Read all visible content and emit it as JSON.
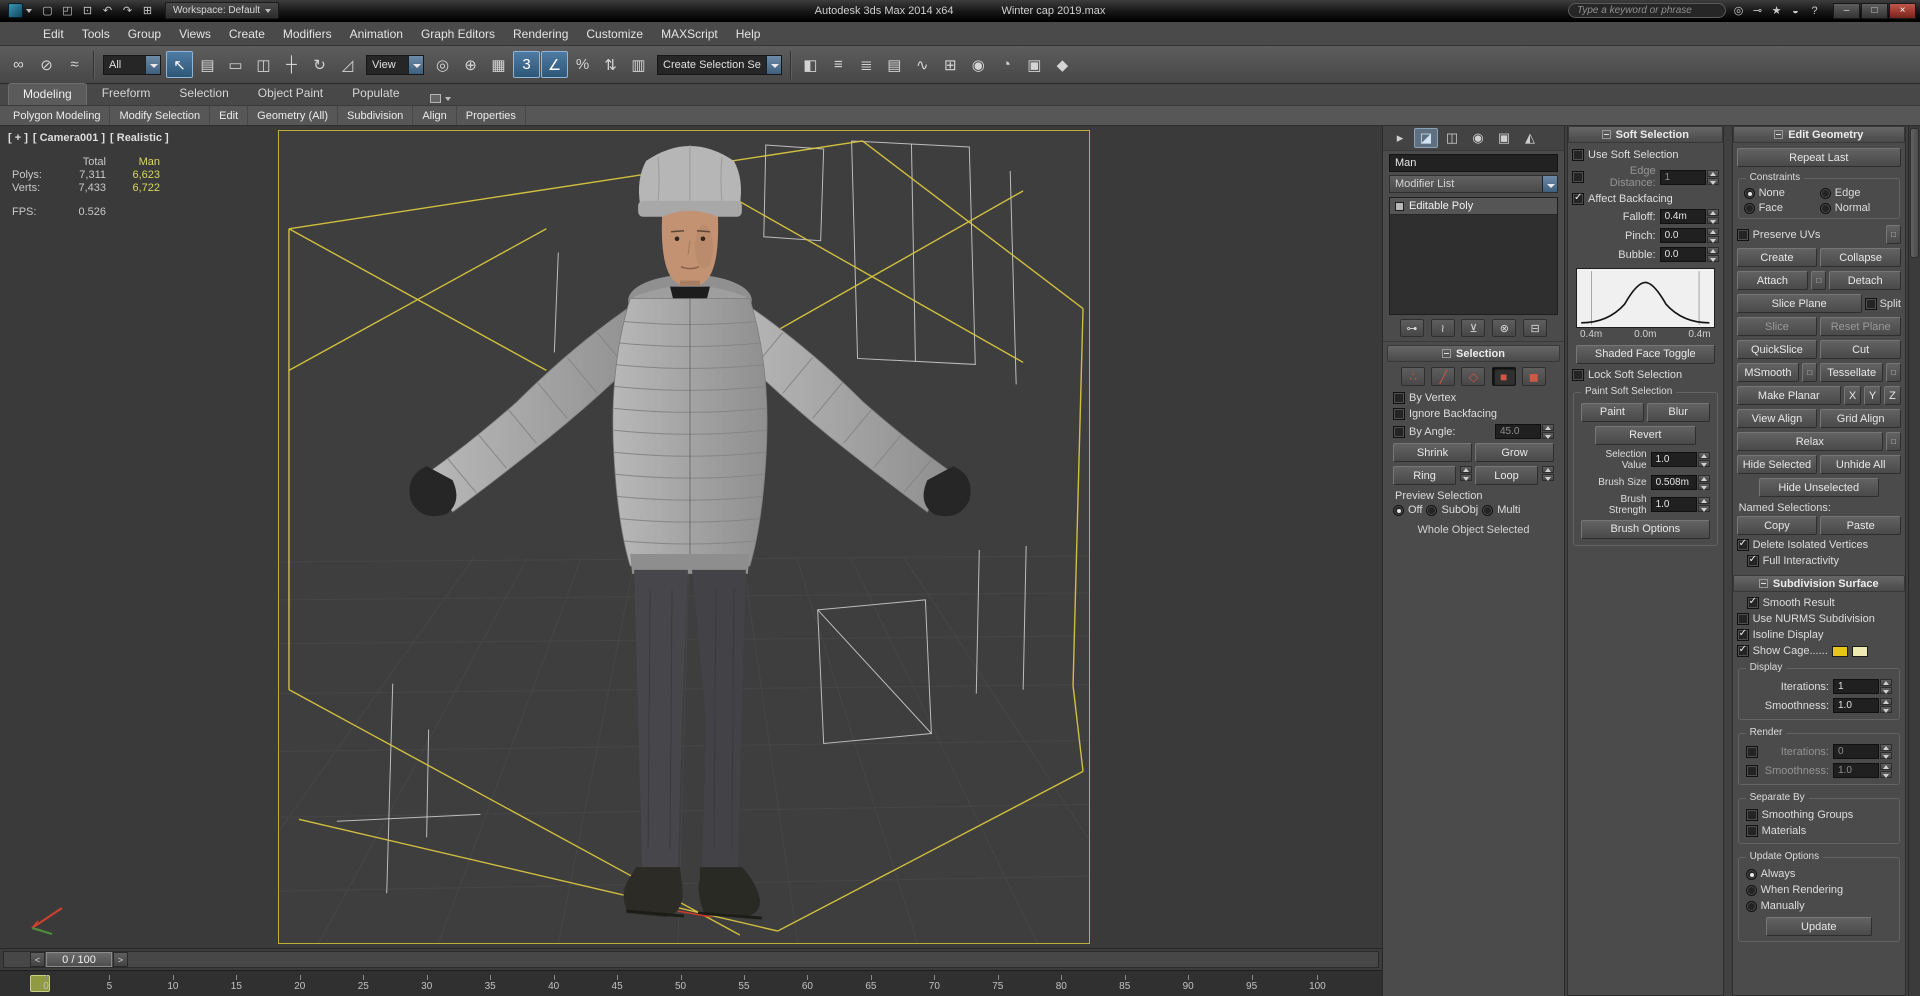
{
  "colors": {
    "cage_yellow": "#d8c63e",
    "viewport_border_yellow": "#c2ae36",
    "selection_stats_yellow": "#d8d85e",
    "accent_blue": "#3e5f7d",
    "close_button_red": "#77231a",
    "cage_swatch_yellow": "#e6c619",
    "cage_swatch_pale": "#efeab2",
    "frame_marker_olive": "#8f9a42"
  },
  "title_bar": {
    "app_title": "Autodesk 3ds Max 2014 x64",
    "file_name": "Winter cap 2019.max",
    "workspace_label": "Workspace: Default",
    "search_placeholder": "Type a keyword or phrase",
    "quick_access": [
      {
        "name": "new-scene-icon",
        "glyph": "▢"
      },
      {
        "name": "open-file-icon",
        "glyph": "◰"
      },
      {
        "name": "save-file-icon",
        "glyph": "⊡"
      },
      {
        "name": "undo-icon",
        "glyph": "↶"
      },
      {
        "name": "redo-icon",
        "glyph": "↷"
      },
      {
        "name": "project-folder-icon",
        "glyph": "⊞"
      }
    ],
    "right_icons": [
      {
        "name": "infocenter-search-icon",
        "glyph": "◎"
      },
      {
        "name": "sign-in-icon",
        "glyph": "⊸"
      },
      {
        "name": "favorites-icon",
        "glyph": "★"
      },
      {
        "name": "communication-center-icon",
        "glyph": "◒"
      },
      {
        "name": "help-icon",
        "glyph": "?"
      }
    ],
    "window_controls": [
      {
        "name": "minimize-button",
        "glyph": "–"
      },
      {
        "name": "maximize-button",
        "glyph": "□"
      },
      {
        "name": "close-button",
        "glyph": "×"
      }
    ]
  },
  "menu_bar": {
    "items": [
      {
        "name": "menu-edit",
        "label": "Edit"
      },
      {
        "name": "menu-tools",
        "label": "Tools"
      },
      {
        "name": "menu-group",
        "label": "Group"
      },
      {
        "name": "menu-views",
        "label": "Views"
      },
      {
        "name": "menu-create",
        "label": "Create"
      },
      {
        "name": "menu-modifiers",
        "label": "Modifiers"
      },
      {
        "name": "menu-animation",
        "label": "Animation"
      },
      {
        "name": "menu-graph-editors",
        "label": "Graph Editors"
      },
      {
        "name": "menu-rendering",
        "label": "Rendering"
      },
      {
        "name": "menu-customize",
        "label": "Customize"
      },
      {
        "name": "menu-maxscript",
        "label": "MAXScript"
      },
      {
        "name": "menu-help",
        "label": "Help"
      }
    ]
  },
  "toolbar": {
    "filter_value": "All",
    "coords_value": "View",
    "sets_value": "Create Selection Se",
    "group1": [
      {
        "name": "select-and-link-icon",
        "glyph": "∞"
      },
      {
        "name": "unlink-selection-icon",
        "glyph": "⊘"
      },
      {
        "name": "bind-to-space-warp-icon",
        "glyph": "≈"
      }
    ],
    "group2": [
      {
        "name": "select-object-icon",
        "glyph": "↖",
        "active": true
      },
      {
        "name": "select-by-name-icon",
        "glyph": "▤"
      },
      {
        "name": "selection-region-icon",
        "glyph": "▭"
      },
      {
        "name": "window-crossing-icon",
        "glyph": "◫"
      },
      {
        "name": "select-and-move-icon",
        "glyph": "┼"
      },
      {
        "name": "select-and-rotate-icon",
        "glyph": "↻"
      },
      {
        "name": "select-and-scale-icon",
        "glyph": "◿"
      }
    ],
    "group3": [
      {
        "name": "use-pivot-center-icon",
        "glyph": "◎"
      },
      {
        "name": "select-and-manipulate-icon",
        "glyph": "⊕"
      },
      {
        "name": "keyboard-override-icon",
        "glyph": "▦"
      },
      {
        "name": "snaps-toggle-icon",
        "glyph": "3",
        "active": true
      },
      {
        "name": "angle-snap-icon",
        "glyph": "∠",
        "active": true
      },
      {
        "name": "percent-snap-icon",
        "glyph": "%"
      },
      {
        "name": "spinner-snap-icon",
        "glyph": "⇅"
      },
      {
        "name": "named-selection-sets-icon",
        "glyph": "▥"
      }
    ],
    "group4": [
      {
        "name": "mirror-icon",
        "glyph": "◧"
      },
      {
        "name": "align-icon",
        "glyph": "≡"
      },
      {
        "name": "layer-manager-icon",
        "glyph": "≣"
      },
      {
        "name": "ribbon-toggle-icon",
        "glyph": "▤"
      },
      {
        "name": "curve-editor-icon",
        "glyph": "∿"
      },
      {
        "name": "schematic-view-icon",
        "glyph": "⊞"
      },
      {
        "name": "material-editor-icon",
        "glyph": "◉"
      },
      {
        "name": "render-setup-icon",
        "glyph": "◔"
      },
      {
        "name": "rendered-frame-icon",
        "glyph": "▣"
      },
      {
        "name": "render-production-icon",
        "glyph": "◆"
      }
    ]
  },
  "ribbon": {
    "tabs": [
      {
        "name": "tab-modeling",
        "label": "Modeling",
        "active": true
      },
      {
        "name": "tab-freeform",
        "label": "Freeform"
      },
      {
        "name": "tab-selection",
        "label": "Selection"
      },
      {
        "name": "tab-object-paint",
        "label": "Object Paint"
      },
      {
        "name": "tab-populate",
        "label": "Populate"
      }
    ],
    "panels": [
      {
        "name": "ribbon-panel-polygon-modeling",
        "label": "Polygon Modeling"
      },
      {
        "name": "ribbon-panel-modify-selection",
        "label": "Modify Selection"
      },
      {
        "name": "ribbon-panel-edit",
        "label": "Edit"
      },
      {
        "name": "ribbon-panel-geometry-all",
        "label": "Geometry (All)"
      },
      {
        "name": "ribbon-panel-subdivision",
        "label": "Subdivision"
      },
      {
        "name": "ribbon-panel-align",
        "label": "Align"
      },
      {
        "name": "ribbon-panel-properties",
        "label": "Properties"
      }
    ]
  },
  "viewport": {
    "menu_plus": "[ + ]",
    "menu_camera": "[ Camera001 ]",
    "menu_shading": "[ Realistic ]",
    "stats": {
      "header_total": "Total",
      "header_selection": "Man",
      "polys_label": "Polys:",
      "polys_total": "7,311",
      "polys_sel": "6,623",
      "verts_label": "Verts:",
      "verts_total": "7,433",
      "verts_sel": "6,722",
      "fps_label": "FPS:",
      "fps_value": "0.526"
    }
  },
  "command_panel": {
    "tabs": [
      {
        "name": "create-tab-icon",
        "glyph": "▸"
      },
      {
        "name": "modify-tab-icon",
        "glyph": "◪",
        "active": true
      },
      {
        "name": "hierarchy-tab-icon",
        "glyph": "◫"
      },
      {
        "name": "motion-tab-icon",
        "glyph": "◉"
      },
      {
        "name": "display-tab-icon",
        "glyph": "▣"
      },
      {
        "name": "utilities-tab-icon",
        "glyph": "◭"
      }
    ],
    "object_name": "Man",
    "modifier_list_label": "Modifier List",
    "stack": [
      {
        "name": "stack-item-editable-poly",
        "label": "Editable Poly"
      }
    ],
    "stack_tools": [
      {
        "name": "pin-stack-icon",
        "glyph": "⊶"
      },
      {
        "name": "show-end-result-icon",
        "glyph": "≀"
      },
      {
        "name": "make-unique-icon",
        "glyph": "⊻"
      },
      {
        "name": "remove-modifier-icon",
        "glyph": "⊗"
      },
      {
        "name": "configure-modifier-sets-icon",
        "glyph": "⊟"
      }
    ],
    "selection": {
      "title": "Selection",
      "subobject_icons": [
        {
          "name": "vertex-icon",
          "glyph": "∴"
        },
        {
          "name": "edge-icon",
          "glyph": "╱"
        },
        {
          "name": "border-icon",
          "glyph": "◇"
        },
        {
          "name": "polygon-icon",
          "glyph": "■",
          "active": true
        },
        {
          "name": "element-icon",
          "glyph": "◼"
        }
      ],
      "by_vertex_label": "By Vertex",
      "ignore_backfacing_label": "Ignore Backfacing",
      "by_angle_label": "By Angle:",
      "by_angle_value": "45.0",
      "shrink_label": "Shrink",
      "grow_label": "Grow",
      "ring_label": "Ring",
      "loop_label": "Loop",
      "preview_title": "Preview Selection",
      "preview_off": "Off",
      "preview_subobj": "SubObj",
      "preview_multi": "Multi",
      "status_text": "Whole Object Selected"
    }
  },
  "soft_selection": {
    "title": "Soft Selection",
    "use_soft_label": "Use Soft Selection",
    "edge_distance_label": "Edge Distance:",
    "edge_distance_value": "1",
    "affect_backfacing_label": "Affect Backfacing",
    "falloff_label": "Falloff:",
    "falloff_value": "0.4m",
    "pinch_label": "Pinch:",
    "pinch_value": "0.0",
    "bubble_label": "Bubble:",
    "bubble_value": "0.0",
    "curve_min": "0.4m",
    "curve_mid": "0.0m",
    "curve_max": "0.4m",
    "shaded_face_label": "Shaded Face Toggle",
    "lock_label": "Lock Soft Selection",
    "paint_group_title": "Paint Soft Selection",
    "paint_label": "Paint",
    "blur_label": "Blur",
    "revert_label": "Revert",
    "selection_value_label": "Selection Value",
    "selection_value": "1.0",
    "brush_size_label": "Brush Size",
    "brush_size_value": "0.508m",
    "brush_strength_label": "Brush Strength",
    "brush_strength_value": "1.0",
    "brush_options_label": "Brush Options"
  },
  "edit_geometry": {
    "title": "Edit Geometry",
    "repeat_last_label": "Repeat Last",
    "constraints_title": "Constraints",
    "constraint_none": "None",
    "constraint_edge": "Edge",
    "constraint_face": "Face",
    "constraint_normal": "Normal",
    "preserve_uvs_label": "Preserve UVs",
    "settings_glyph": "□",
    "create_label": "Create",
    "collapse_label": "Collapse",
    "attach_label": "Attach",
    "detach_label": "Detach",
    "slice_plane_label": "Slice Plane",
    "split_label": "Split",
    "slice_label": "Slice",
    "reset_plane_label": "Reset Plane",
    "quickslice_label": "QuickSlice",
    "cut_label": "Cut",
    "msmooth_label": "MSmooth",
    "tessellate_label": "Tessellate",
    "make_planar_label": "Make Planar",
    "x_label": "X",
    "y_label": "Y",
    "z_label": "Z",
    "view_align_label": "View Align",
    "grid_align_label": "Grid Align",
    "relax_label": "Relax",
    "hide_selected_label": "Hide Selected",
    "unhide_all_label": "Unhide All",
    "hide_unselected_label": "Hide Unselected",
    "named_selections_label": "Named Selections:",
    "copy_label": "Copy",
    "paste_label": "Paste",
    "delete_isolated_label": "Delete Isolated Vertices",
    "full_interactivity_label": "Full Interactivity"
  },
  "subdivision_surface": {
    "title": "Subdivision Surface",
    "smooth_result_label": "Smooth Result",
    "use_nurms_label": "Use NURMS Subdivision",
    "isoline_label": "Isoline Display",
    "show_cage_label": "Show Cage......",
    "display_title": "Display",
    "iterations_label": "Iterations:",
    "display_iterations": "1",
    "smoothness_label": "Smoothness:",
    "display_smoothness": "1.0",
    "render_title": "Render",
    "render_iterations": "0",
    "render_smoothness": "1.0",
    "separate_by_title": "Separate By",
    "smoothing_groups_label": "Smoothing Groups",
    "materials_label": "Materials",
    "update_options_title": "Update Options",
    "always_label": "Always",
    "when_rendering_label": "When Rendering",
    "manually_label": "Manually",
    "update_label": "Update"
  },
  "timeline": {
    "frame_display": "0 / 100",
    "prev_glyph": "<",
    "next_glyph": ">",
    "ticks": [
      "0",
      "5",
      "10",
      "15",
      "20",
      "25",
      "30",
      "35",
      "40",
      "45",
      "50",
      "55",
      "60",
      "65",
      "70",
      "75",
      "80",
      "85",
      "90",
      "95",
      "100"
    ]
  }
}
